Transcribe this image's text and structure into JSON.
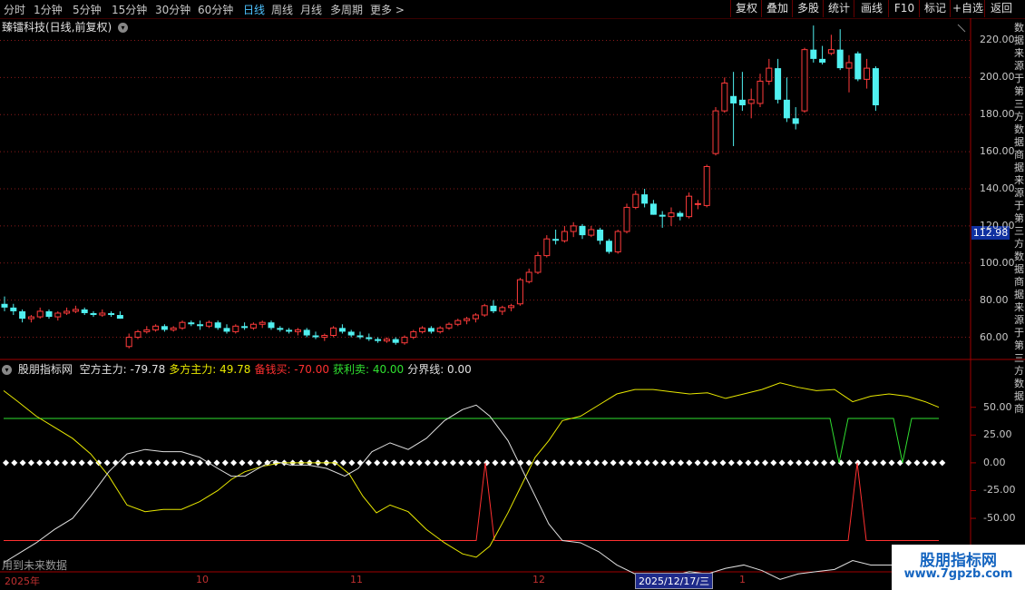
{
  "toolbar": {
    "periods": [
      "分时",
      "1分钟",
      "5分钟",
      "15分钟",
      "30分钟",
      "60分钟",
      "日线",
      "周线",
      "月线",
      "多周期",
      "更多 >"
    ],
    "active_period": "日线",
    "buttons": [
      "复权",
      "叠加",
      "多股",
      "统计",
      "画线",
      "F10",
      "标记",
      "+自选",
      "返回"
    ]
  },
  "main_chart": {
    "title": "臻镭科技(日线,前复权)",
    "current_price": "112.98",
    "price_axis_labels": [
      "220.00",
      "200.00",
      "180.00",
      "160.00",
      "140.00",
      "120.00",
      "100.00",
      "80.00",
      "60.00"
    ],
    "price_range": [
      50,
      230
    ]
  },
  "indicator": {
    "name": "股朋指标网",
    "values": [
      {
        "label": "空方主力:",
        "value": "-79.78",
        "color": "#e0e0e0"
      },
      {
        "label": "多方主力:",
        "value": "49.78",
        "color": "#e8e800"
      },
      {
        "label": "备钱买:",
        "value": "-70.00",
        "color": "#ff3030"
      },
      {
        "label": "获利卖:",
        "value": "40.00",
        "color": "#30e030"
      },
      {
        "label": "分界线:",
        "value": "0.00",
        "color": "#e0e0e0"
      }
    ],
    "axis_labels": [
      "50.00",
      "25.00",
      "0.00",
      "-25.00",
      "-50.00"
    ],
    "note": "用到未来数据"
  },
  "x_axis": {
    "labels": [
      "2025年",
      "10",
      "11",
      "12",
      "1"
    ],
    "cursor_date": "2025/12/17/三"
  },
  "watermark": {
    "line1": "股朋指标网",
    "line2": "www.7gpzb.com"
  },
  "side_chars": "数据来源于第三方数据商据来源于第三方数据商据来源于第三方数据商",
  "colors": {
    "up": "#ff3b3b",
    "down": "#50f0f0",
    "grid": "#8a1a1a",
    "bull_line": "#e8e800",
    "bear_line": "#e0e0e0",
    "buy_line": "#ff3030",
    "sell_line": "#30e030"
  },
  "chart_data": {
    "type": "candlestick",
    "candles": [
      [
        78,
        82,
        74,
        76
      ],
      [
        76,
        78,
        72,
        74
      ],
      [
        74,
        75,
        68,
        70
      ],
      [
        70,
        72,
        68,
        71
      ],
      [
        71,
        76,
        70,
        74
      ],
      [
        74,
        75,
        70,
        71
      ],
      [
        71,
        74,
        69,
        73
      ],
      [
        73,
        76,
        72,
        74
      ],
      [
        74,
        77,
        73,
        75
      ],
      [
        75,
        76,
        72,
        73
      ],
      [
        73,
        74,
        71,
        72
      ],
      [
        72,
        75,
        71,
        73
      ],
      [
        73,
        74,
        71,
        72
      ],
      [
        72,
        74,
        70,
        70
      ],
      [
        55,
        62,
        54,
        60
      ],
      [
        60,
        64,
        59,
        63
      ],
      [
        63,
        66,
        62,
        64
      ],
      [
        64,
        67,
        63,
        66
      ],
      [
        66,
        67,
        63,
        64
      ],
      [
        64,
        66,
        63,
        65
      ],
      [
        65,
        69,
        64,
        68
      ],
      [
        68,
        69,
        66,
        67
      ],
      [
        67,
        69,
        64,
        66
      ],
      [
        66,
        69,
        65,
        68
      ],
      [
        68,
        69,
        64,
        65
      ],
      [
        65,
        67,
        62,
        63
      ],
      [
        63,
        67,
        62,
        66
      ],
      [
        66,
        68,
        64,
        65
      ],
      [
        65,
        68,
        64,
        67
      ],
      [
        67,
        69,
        65,
        68
      ],
      [
        68,
        69,
        64,
        65
      ],
      [
        65,
        66,
        63,
        64
      ],
      [
        64,
        65,
        62,
        63
      ],
      [
        63,
        65,
        61,
        64
      ],
      [
        64,
        65,
        60,
        61
      ],
      [
        61,
        63,
        59,
        60
      ],
      [
        60,
        62,
        58,
        61
      ],
      [
        61,
        66,
        60,
        65
      ],
      [
        65,
        67,
        62,
        63
      ],
      [
        63,
        64,
        60,
        61
      ],
      [
        61,
        63,
        59,
        60
      ],
      [
        60,
        62,
        58,
        59
      ],
      [
        59,
        60,
        57,
        58
      ],
      [
        58,
        60,
        57,
        59
      ],
      [
        59,
        60,
        56,
        57
      ],
      [
        57,
        61,
        56,
        60
      ],
      [
        60,
        64,
        59,
        63
      ],
      [
        63,
        66,
        62,
        65
      ],
      [
        65,
        66,
        62,
        63
      ],
      [
        63,
        66,
        62,
        65
      ],
      [
        65,
        68,
        64,
        67
      ],
      [
        67,
        70,
        66,
        69
      ],
      [
        69,
        71,
        67,
        70
      ],
      [
        70,
        73,
        68,
        72
      ],
      [
        72,
        78,
        71,
        77
      ],
      [
        77,
        80,
        73,
        74
      ],
      [
        74,
        77,
        72,
        76
      ],
      [
        76,
        78,
        74,
        77
      ],
      [
        78,
        92,
        77,
        91
      ],
      [
        90,
        97,
        89,
        95
      ],
      [
        95,
        106,
        94,
        104
      ],
      [
        104,
        115,
        103,
        113
      ],
      [
        113,
        118,
        110,
        112
      ],
      [
        112,
        120,
        111,
        117
      ],
      [
        117,
        122,
        114,
        120
      ],
      [
        120,
        121,
        113,
        115
      ],
      [
        115,
        120,
        114,
        118
      ],
      [
        118,
        119,
        110,
        112
      ],
      [
        112,
        113,
        105,
        106
      ],
      [
        106,
        118,
        105,
        117
      ],
      [
        117,
        132,
        116,
        130
      ],
      [
        130,
        139,
        129,
        137
      ],
      [
        137,
        140,
        130,
        132
      ],
      [
        132,
        134,
        126,
        126
      ],
      [
        126,
        128,
        119,
        125
      ],
      [
        125,
        130,
        120,
        127
      ],
      [
        127,
        128,
        123,
        125
      ],
      [
        125,
        138,
        124,
        136
      ],
      [
        132,
        134,
        129,
        132
      ],
      [
        131,
        153,
        130,
        152
      ],
      [
        159,
        184,
        158,
        182
      ],
      [
        182,
        200,
        181,
        197
      ],
      [
        190,
        203,
        163,
        186
      ],
      [
        188,
        203,
        182,
        185
      ],
      [
        186,
        194,
        178,
        188
      ],
      [
        186,
        202,
        184,
        198
      ],
      [
        198,
        210,
        196,
        205
      ],
      [
        205,
        210,
        186,
        188
      ],
      [
        188,
        200,
        176,
        178
      ],
      [
        178,
        184,
        172,
        175
      ],
      [
        182,
        216,
        181,
        215
      ],
      [
        215,
        228,
        208,
        210
      ],
      [
        210,
        217,
        207,
        208
      ],
      [
        213,
        223,
        212,
        215
      ],
      [
        215,
        226,
        204,
        205
      ],
      [
        205,
        212,
        192,
        208
      ],
      [
        213,
        214,
        198,
        199
      ],
      [
        199,
        210,
        194,
        205
      ],
      [
        205,
        206,
        182,
        185
      ]
    ],
    "indicator_range": [
      -90,
      80
    ]
  }
}
